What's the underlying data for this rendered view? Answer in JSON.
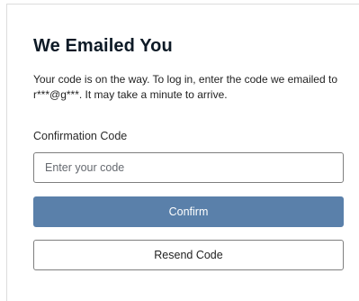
{
  "dialog": {
    "title": "We Emailed You",
    "message": "Your code is on the way. To log in, enter the code we emailed to r***@g***. It may take a minute to arrive.",
    "code_label": "Confirmation Code",
    "code_placeholder": "Enter your code",
    "code_value": "",
    "confirm_label": "Confirm",
    "resend_label": "Resend Code"
  },
  "colors": {
    "primary_button": "#5a80aa",
    "border": "#7f7f7f"
  }
}
